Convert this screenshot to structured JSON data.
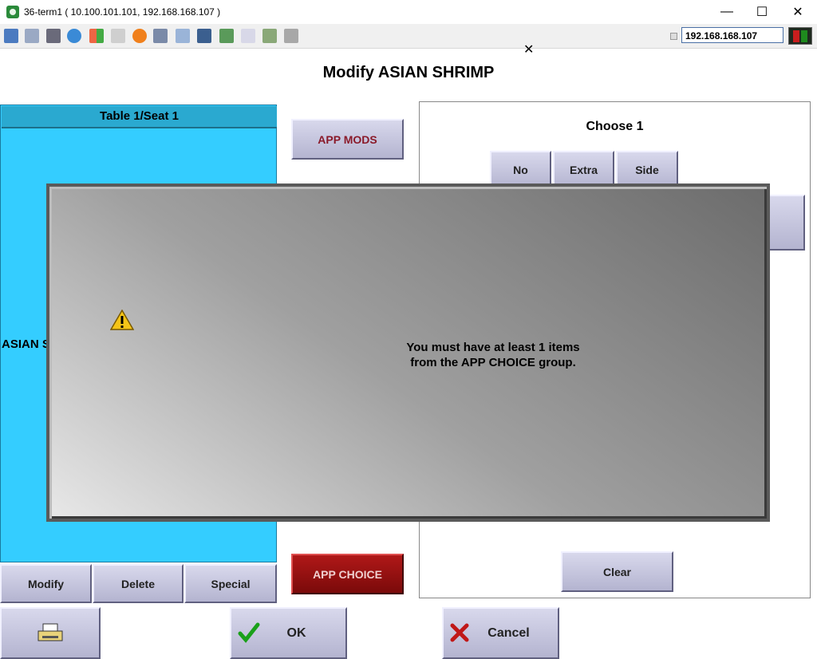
{
  "window": {
    "title": "36-term1 ( 10.100.101.101, 192.168.168.107 )",
    "minimize": "—",
    "maximize": "☐",
    "close": "✕"
  },
  "toolbar": {
    "ip_value": "192.168.168.107",
    "icons": [
      "monitor-icon",
      "windows-icon",
      "tools-icon",
      "refresh-icon",
      "windows-logo-icon",
      "keyboard-icon",
      "alert-icon",
      "network-icon",
      "fullscreen-icon",
      "screen-icon",
      "transfer-icon",
      "document-icon",
      "map-icon",
      "chat-icon"
    ]
  },
  "screen": {
    "page_title": "Modify ASIAN SHRIMP",
    "close_glyph": "✕",
    "order": {
      "header": "Table 1/Seat 1",
      "item": "ASIAN S"
    },
    "buttons": {
      "app_mods": "APP MODS",
      "app_choice": "APP CHOICE",
      "modify": "Modify",
      "delete": "Delete",
      "special": "Special",
      "ok": "OK",
      "cancel": "Cancel",
      "clear": "Clear"
    },
    "choose": {
      "title": "Choose 1",
      "options": [
        "No",
        "Extra",
        "Side"
      ]
    },
    "dialog": {
      "line1": "You must have at least 1 items",
      "line2": "from the APP CHOICE group."
    },
    "colors": {
      "order_panel": "#34cdff",
      "app_choice": "#9a1010",
      "button_face": "#c4c4dc"
    }
  }
}
